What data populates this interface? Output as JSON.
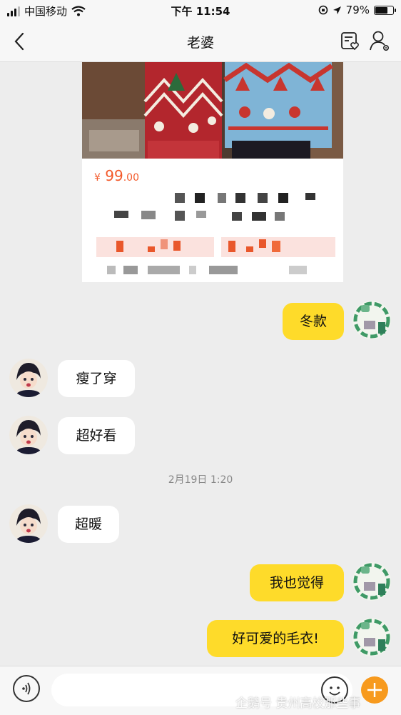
{
  "status_bar": {
    "carrier": "中国移动",
    "time": "下午 11:54",
    "battery_percent": "79%",
    "battery_level": 0.79,
    "icons": [
      "signal-icon",
      "wifi-icon",
      "lock-rotation-icon",
      "location-icon",
      "battery-icon"
    ]
  },
  "header": {
    "title": "老婆",
    "icons": [
      "back-icon",
      "note-heart-icon",
      "profile-settings-icon"
    ]
  },
  "product_card": {
    "currency": "¥",
    "price": "99",
    "price_decimals": ".00"
  },
  "messages": [
    {
      "from": "me",
      "text": "冬款"
    },
    {
      "from": "them",
      "text": "瘦了穿"
    },
    {
      "from": "them",
      "text": "超好看"
    },
    {
      "from": "them",
      "text": "超暖"
    },
    {
      "from": "me",
      "text": "我也觉得"
    },
    {
      "from": "me",
      "text": "好可爱的毛衣!"
    }
  ],
  "timestamp": "2月19日 1:20",
  "input_bar": {
    "placeholder": "",
    "icons": [
      "voice-icon",
      "emoji-icon",
      "plus-icon"
    ]
  },
  "watermark": "企鹅号 贵州高校那些事",
  "colors": {
    "my_bubble": "#fedb2a",
    "their_bubble": "#ffffff",
    "price": "#f35a2b",
    "background": "#ededed",
    "plus_button": "#f79a1e"
  }
}
